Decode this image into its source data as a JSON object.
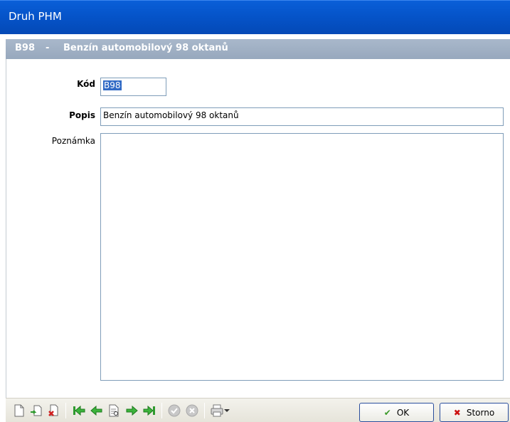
{
  "window": {
    "title": "Druh PHM"
  },
  "header": {
    "code": "B98",
    "separator": "-",
    "description": "Benzín automobilový 98 oktanů"
  },
  "form": {
    "kod_label": "Kód",
    "kod_value": "B98",
    "popis_label": "Popis",
    "popis_value": "Benzín automobilový 98 oktanů",
    "poznamka_label": "Poznámka",
    "poznamka_value": ""
  },
  "toolbar": {
    "icons": [
      "new-icon",
      "copy-icon",
      "delete-icon",
      "first-record-icon",
      "previous-record-icon",
      "detail-icon",
      "next-record-icon",
      "last-record-icon",
      "confirm-icon",
      "cancel-icon",
      "print-icon",
      "dropdown-arrow-icon"
    ],
    "ok_label": "OK",
    "storno_label": "Storno"
  },
  "colors": {
    "title_bar": "#0553c8",
    "subheader": "#a1b1c5",
    "ok_check": "#3c9a2a",
    "storno_x": "#cc1010",
    "nav_arrows": "#2e9a2e"
  }
}
